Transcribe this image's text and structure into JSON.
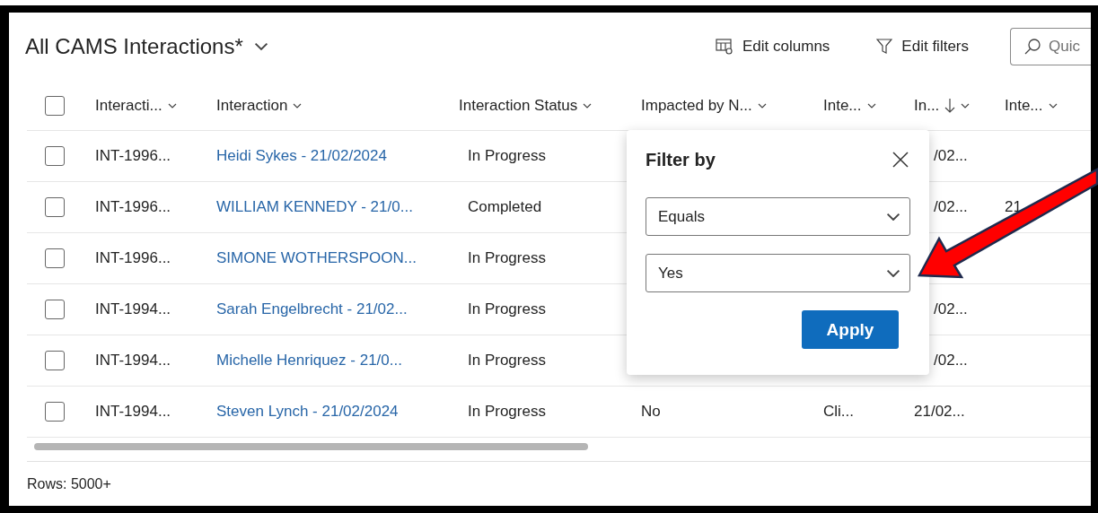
{
  "view": {
    "title": "All CAMS Interactions*"
  },
  "toolbar": [
    {
      "kind": "columns",
      "label": "Edit columns"
    },
    {
      "kind": "filters",
      "label": "Edit filters"
    }
  ],
  "search": {
    "placeholder": "Quic"
  },
  "table": {
    "select_all_checked": false,
    "columns": [
      {
        "label": "Interacti..."
      },
      {
        "label": "Interaction"
      },
      {
        "label": "Interaction Status"
      },
      {
        "label": "Impacted by N..."
      },
      {
        "label": "Inte..."
      },
      {
        "label": "In...",
        "sorted_descending": true
      },
      {
        "label": "Inte..."
      }
    ],
    "rows": [
      {
        "checked": false,
        "partly_covered": true,
        "cells": [
          "INT-1996...",
          "Heidi Sykes - 21/02/2024",
          "In Progress",
          "",
          "",
          "/02...",
          ""
        ]
      },
      {
        "checked": false,
        "partly_covered": true,
        "cells": [
          "INT-1996...",
          "WILLIAM KENNEDY - 21/0...",
          "Completed",
          "",
          "",
          "/02...",
          "21"
        ]
      },
      {
        "checked": false,
        "cells": [
          "INT-1996...",
          "SIMONE WOTHERSPOON...",
          "In Progress",
          "",
          "",
          "",
          ""
        ]
      },
      {
        "checked": false,
        "partly_covered": true,
        "cells": [
          "INT-1994...",
          "Sarah Engelbrecht - 21/02...",
          "In Progress",
          "",
          "",
          "/02...",
          ""
        ]
      },
      {
        "checked": false,
        "partly_covered": true,
        "cells": [
          "INT-1994...",
          "Michelle Henriquez - 21/0...",
          "In Progress",
          "",
          "",
          "/02...",
          ""
        ]
      },
      {
        "checked": false,
        "cells": [
          "INT-1994...",
          "Steven Lynch - 21/02/2024",
          "In Progress",
          "No",
          "Cli...",
          "21/02...",
          ""
        ]
      }
    ]
  },
  "footer": {
    "rows": "Rows: 5000+"
  },
  "filter_popup": {
    "title": "Filter by",
    "operator": "Equals",
    "value": "Yes",
    "apply": "Apply"
  }
}
